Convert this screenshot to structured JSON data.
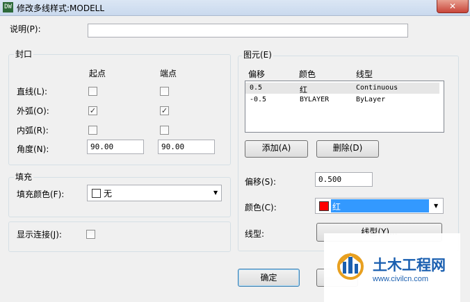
{
  "window": {
    "title": "修改多线样式:MODELL",
    "icon_text": "DW",
    "close_glyph": "✕"
  },
  "description": {
    "label": "说明(P):",
    "value": ""
  },
  "caps": {
    "title": "封口",
    "col_start": "起点",
    "col_end": "端点",
    "rows": [
      {
        "label": "直线(L):",
        "start_checked": false,
        "end_checked": false
      },
      {
        "label": "外弧(O):",
        "start_checked": true,
        "end_checked": true
      },
      {
        "label": "内弧(R):",
        "start_checked": false,
        "end_checked": false
      }
    ],
    "angle_label": "角度(N):",
    "angle_start": "90.00",
    "angle_end": "90.00"
  },
  "fill": {
    "title": "填充",
    "color_label": "填充颜色(F):",
    "color_value": "无"
  },
  "show_joints": {
    "label": "显示连接(J):",
    "checked": false
  },
  "elements": {
    "title": "图元(E)",
    "headers": {
      "offset": "偏移",
      "color": "颜色",
      "linetype": "线型"
    },
    "rows": [
      {
        "offset": "0.5",
        "color": "红",
        "linetype": "Continuous"
      },
      {
        "offset": "-0.5",
        "color": "BYLAYER",
        "linetype": "ByLayer"
      }
    ],
    "add_button": "添加(A)",
    "delete_button": "删除(D)",
    "offset_label": "偏移(S):",
    "offset_value": "0.500",
    "color_label": "颜色(C):",
    "color_value": "红",
    "color_swatch": "#ff0000",
    "linetype_label": "线型:",
    "linetype_button": "线型(Y)..."
  },
  "buttons": {
    "ok": "确定"
  },
  "watermark": {
    "brand": "土木工程网",
    "url": "www.civilcn.com"
  },
  "colors": {
    "selection": "#3399ff",
    "accent_blue": "#1a5fb0",
    "watermark_orange": "#e8a020"
  }
}
